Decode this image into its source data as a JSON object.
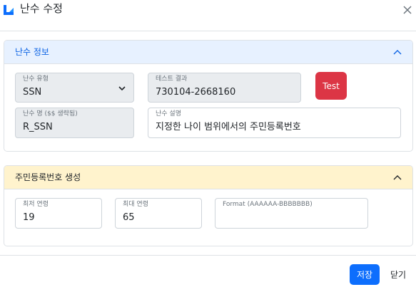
{
  "header": {
    "title": "난수 수정",
    "logo_icon": "logo-icon",
    "close_icon": "close-icon"
  },
  "section_info": {
    "title": "난수 정보",
    "type_field": {
      "label": "난수 유형",
      "value": "SSN"
    },
    "test_result": {
      "label": "테스트 결과",
      "value": "730104-2668160"
    },
    "test_button": "Test",
    "name_field": {
      "label": "난수 명 ($$ 생략됨)",
      "value": "R_SSN"
    },
    "desc_field": {
      "label": "난수 설명",
      "value": "지정한 나이 범위에서의 주민등록번호"
    }
  },
  "section_gen": {
    "title": "주민등록번호 생성",
    "min_age": {
      "label": "최저 연령",
      "value": "19"
    },
    "max_age": {
      "label": "최대 연령",
      "value": "65"
    },
    "format": {
      "label": "Format (AAAAAA-BBBBBBB)",
      "value": ""
    }
  },
  "footer": {
    "save": "저장",
    "close": "닫기"
  },
  "colors": {
    "primary": "#0d6efd",
    "danger": "#dc3545",
    "info_header": "#e7f1ff",
    "gen_header": "#fff3cd"
  }
}
